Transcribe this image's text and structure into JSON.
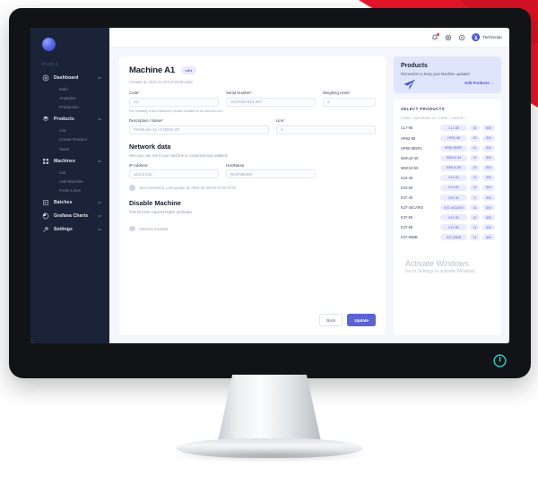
{
  "brand": {
    "accent": "#5b63d3",
    "promo_bg": "#dfe6fb",
    "sidebar_bg": "#1b2338",
    "red": "#e5484d",
    "power_teal": "#1fd3c6"
  },
  "sidebar": {
    "section_label": "PAGES",
    "groups": [
      {
        "label": "Dashboard",
        "icon": "dashboard-icon",
        "expanded": true,
        "children": [
          "Main",
          "Analytics",
          "Production"
        ]
      },
      {
        "label": "Products",
        "icon": "products-icon",
        "expanded": true,
        "children": [
          "List",
          "Create Product",
          "Tares"
        ]
      },
      {
        "label": "Machines",
        "icon": "machines-icon",
        "expanded": true,
        "children": [
          "List",
          "Add Machine",
          "Fresh Lines"
        ]
      },
      {
        "label": "Batches",
        "icon": "batches-icon",
        "expanded": false,
        "children": []
      },
      {
        "label": "Grafana Charts",
        "icon": "chart-icon",
        "expanded": false,
        "children": []
      },
      {
        "label": "Settings",
        "icon": "settings-icon",
        "expanded": false,
        "children": []
      }
    ]
  },
  "topbar": {
    "icons": [
      "bell-icon",
      "gear-icon",
      "help-icon"
    ],
    "has_notification": true,
    "user_name": "Technician"
  },
  "page": {
    "title": "Machine A1",
    "edit_badge": "edit",
    "created_at": "Created at: 2023-11-22T13:18:30.245Z"
  },
  "form": {
    "code": {
      "label": "Code",
      "required": true,
      "value": "A1"
    },
    "serial": {
      "label": "Serial Number",
      "required": true,
      "value": "SAC/093-812-327"
    },
    "units": {
      "label": "Weighing Units",
      "required": true,
      "value": "3"
    },
    "helper": "For creating a New Machine please contact us at daclons.com",
    "description": {
      "label": "Description / Name",
      "required": true,
      "value": "FreshLine A1 / CHECK 07"
    },
    "line": {
      "label": "Line",
      "required": true,
      "value": "A"
    }
  },
  "network": {
    "title": "Network data",
    "subtitle": "Here you can see if your machine is connected and updated.",
    "ip": {
      "label": "IP Address",
      "value": "10.0.2.210"
    },
    "host": {
      "label": "HostName",
      "value": "RevPi88409"
    },
    "status": "Not Connected. Last update at: 2024-02-06T20:47:50.377Z"
  },
  "disable": {
    "title": "Disable Machine",
    "subtitle": "This function requires higher privileges.",
    "status": "Machine Enabled"
  },
  "actions": {
    "back": "Back",
    "update": "Update"
  },
  "promo": {
    "title": "Products",
    "subtitle": "Remember to keep your Machine updated.",
    "link": "Edit Products →",
    "icon": "paper-plane-icon"
  },
  "products_panel": {
    "title": "SELECT PRODUCTS",
    "columns_label": "CODE / INTERNAL ID / TARE / TARGET",
    "rows": [
      {
        "code": "CL7-85",
        "id": "CL7-85",
        "tare": "30",
        "target": "500"
      },
      {
        "code": "HP62-58",
        "id": "HP62-58",
        "tare": "20",
        "target": "500"
      },
      {
        "code": "HP80-85SPL",
        "id": "HP80-85SPL",
        "tare": "41",
        "target": "500"
      },
      {
        "code": "MSK10-40",
        "id": "MSK10-40",
        "tare": "12",
        "target": "500"
      },
      {
        "code": "MSK10-50",
        "id": "MSK10-50",
        "tare": "15",
        "target": "500"
      },
      {
        "code": "K10-40",
        "id": "K10-40",
        "tare": "10",
        "target": "500"
      },
      {
        "code": "K10-50",
        "id": "K10-50",
        "tare": "13",
        "target": "500"
      },
      {
        "code": "K37-40",
        "id": "K37-40",
        "tare": "9",
        "target": "500"
      },
      {
        "code": "K37-40CARO",
        "id": "K37-40CARO",
        "tare": "16",
        "target": "500"
      },
      {
        "code": "K37-50",
        "id": "K37-50",
        "tare": "10",
        "target": "500"
      },
      {
        "code": "K37-55",
        "id": "K37-55",
        "tare": "14",
        "target": "500"
      },
      {
        "code": "K37-55BB",
        "id": "K37-55BB",
        "tare": "14",
        "target": "500"
      }
    ]
  },
  "watermark": {
    "line1": "Activate Windows",
    "line2": "Go to Settings to activate Windows."
  }
}
